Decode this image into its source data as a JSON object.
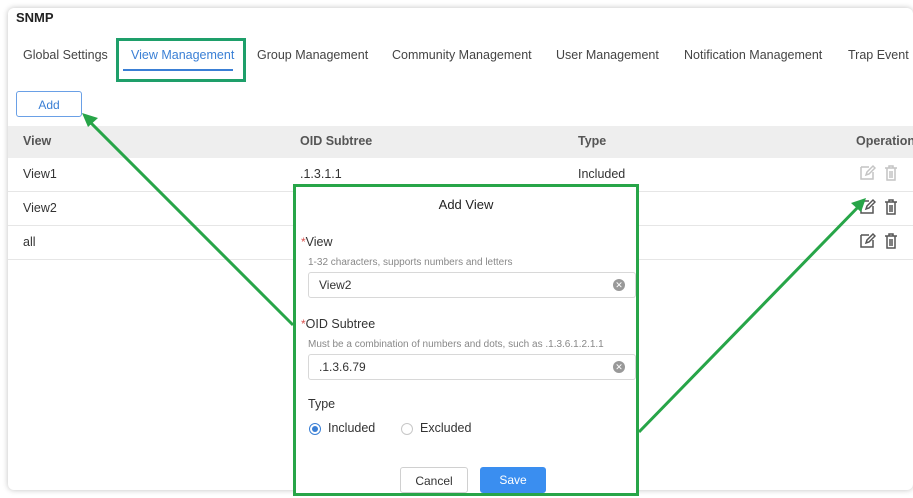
{
  "page": {
    "title": "SNMP"
  },
  "tabs": [
    {
      "label": "Global Settings"
    },
    {
      "label": "View Management"
    },
    {
      "label": "Group Management"
    },
    {
      "label": "Community Management"
    },
    {
      "label": "User Management"
    },
    {
      "label": "Notification Management"
    },
    {
      "label": "Trap Event"
    }
  ],
  "toolbar": {
    "add_label": "Add"
  },
  "table": {
    "headers": {
      "view": "View",
      "oid": "OID Subtree",
      "type": "Type",
      "operation": "Operation"
    },
    "rows": [
      {
        "view": "View1",
        "oid": ".1.3.1.1",
        "type": "Included"
      },
      {
        "view": "View2",
        "oid": "",
        "type": ""
      },
      {
        "view": "all",
        "oid": "",
        "type": ""
      }
    ]
  },
  "modal": {
    "title": "Add View",
    "required_mark": "*",
    "view_label": "View",
    "view_hint": "1-32 characters, supports numbers and letters",
    "view_value": "View2",
    "oid_label": "OID Subtree",
    "oid_hint": "Must be a combination of numbers and dots, such as .1.3.6.1.2.1.1",
    "oid_value": ".1.3.6.79",
    "type_label": "Type",
    "type_options": {
      "included": "Included",
      "excluded": "Excluded"
    },
    "type_selected": "Included",
    "cancel_label": "Cancel",
    "save_label": "Save"
  },
  "colors": {
    "accent": "#3a7fd5",
    "highlight_teal": "#1e9f6a",
    "annotation_green": "#27a548",
    "save_button": "#3a8ef0"
  },
  "icons": [
    "edit-icon",
    "trash-icon",
    "clear-icon",
    "arrow-icon"
  ]
}
